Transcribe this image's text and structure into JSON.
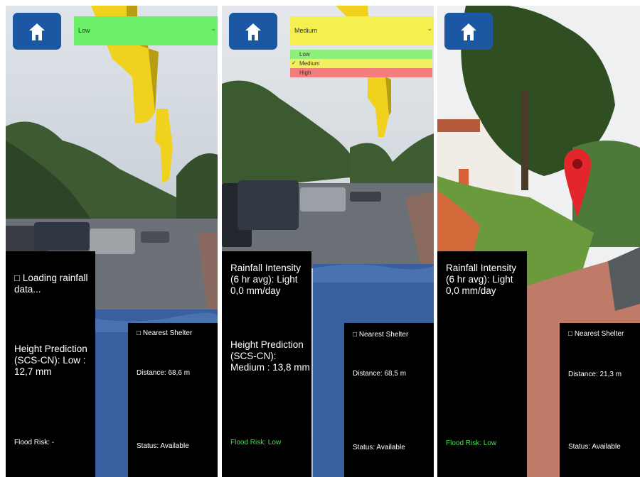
{
  "panels": [
    {
      "dropdown": {
        "value": "Low",
        "color": "#6cf06a"
      },
      "left": {
        "status": "□ Loading rainfall data...",
        "height": "Height Prediction (SCS-CN): Low : 12,7 mm",
        "risk": "Flood Risk: -"
      },
      "right": {
        "shelter": "□ Nearest Shelter",
        "distance": "Distance: 68,6 m",
        "status": "Status: Available"
      },
      "icon": "yellow-arrow-icon"
    },
    {
      "dropdown": {
        "value": "Medium",
        "color": "#f5f04f"
      },
      "options": [
        {
          "label": "Low",
          "color": "#8ef07a",
          "checked": false
        },
        {
          "label": "Medium",
          "color": "#f2ef60",
          "checked": true
        },
        {
          "label": "High",
          "color": "#f37d7d",
          "checked": false
        }
      ],
      "checkmark": "✓",
      "left": {
        "rainfall": "Rainfall Intensity (6 hr avg): Light 0,0 mm/day",
        "height": "Height Prediction (SCS-CN): Medium : 13,8 mm",
        "risk": "Flood Risk: Low"
      },
      "right": {
        "shelter": "□ Nearest Shelter",
        "distance": "Distance: 68,5 m",
        "status": "Status: Available"
      },
      "icon": "yellow-arrow-icon"
    },
    {
      "left": {
        "rainfall": "Rainfall Intensity (6 hr avg): Light 0,0 mm/day",
        "risk": "Flood Risk: Low"
      },
      "right": {
        "shelter": "□ Nearest Shelter",
        "distance": "Distance: 21,3 m",
        "status": "Status: Available"
      },
      "icon": "red-location-pin-icon"
    }
  ],
  "colors": {
    "home_button": "#1c57a3",
    "flood_risk_low": "#41e04c",
    "info_background": "#000000",
    "water_overlay": "#3a5f9e"
  }
}
